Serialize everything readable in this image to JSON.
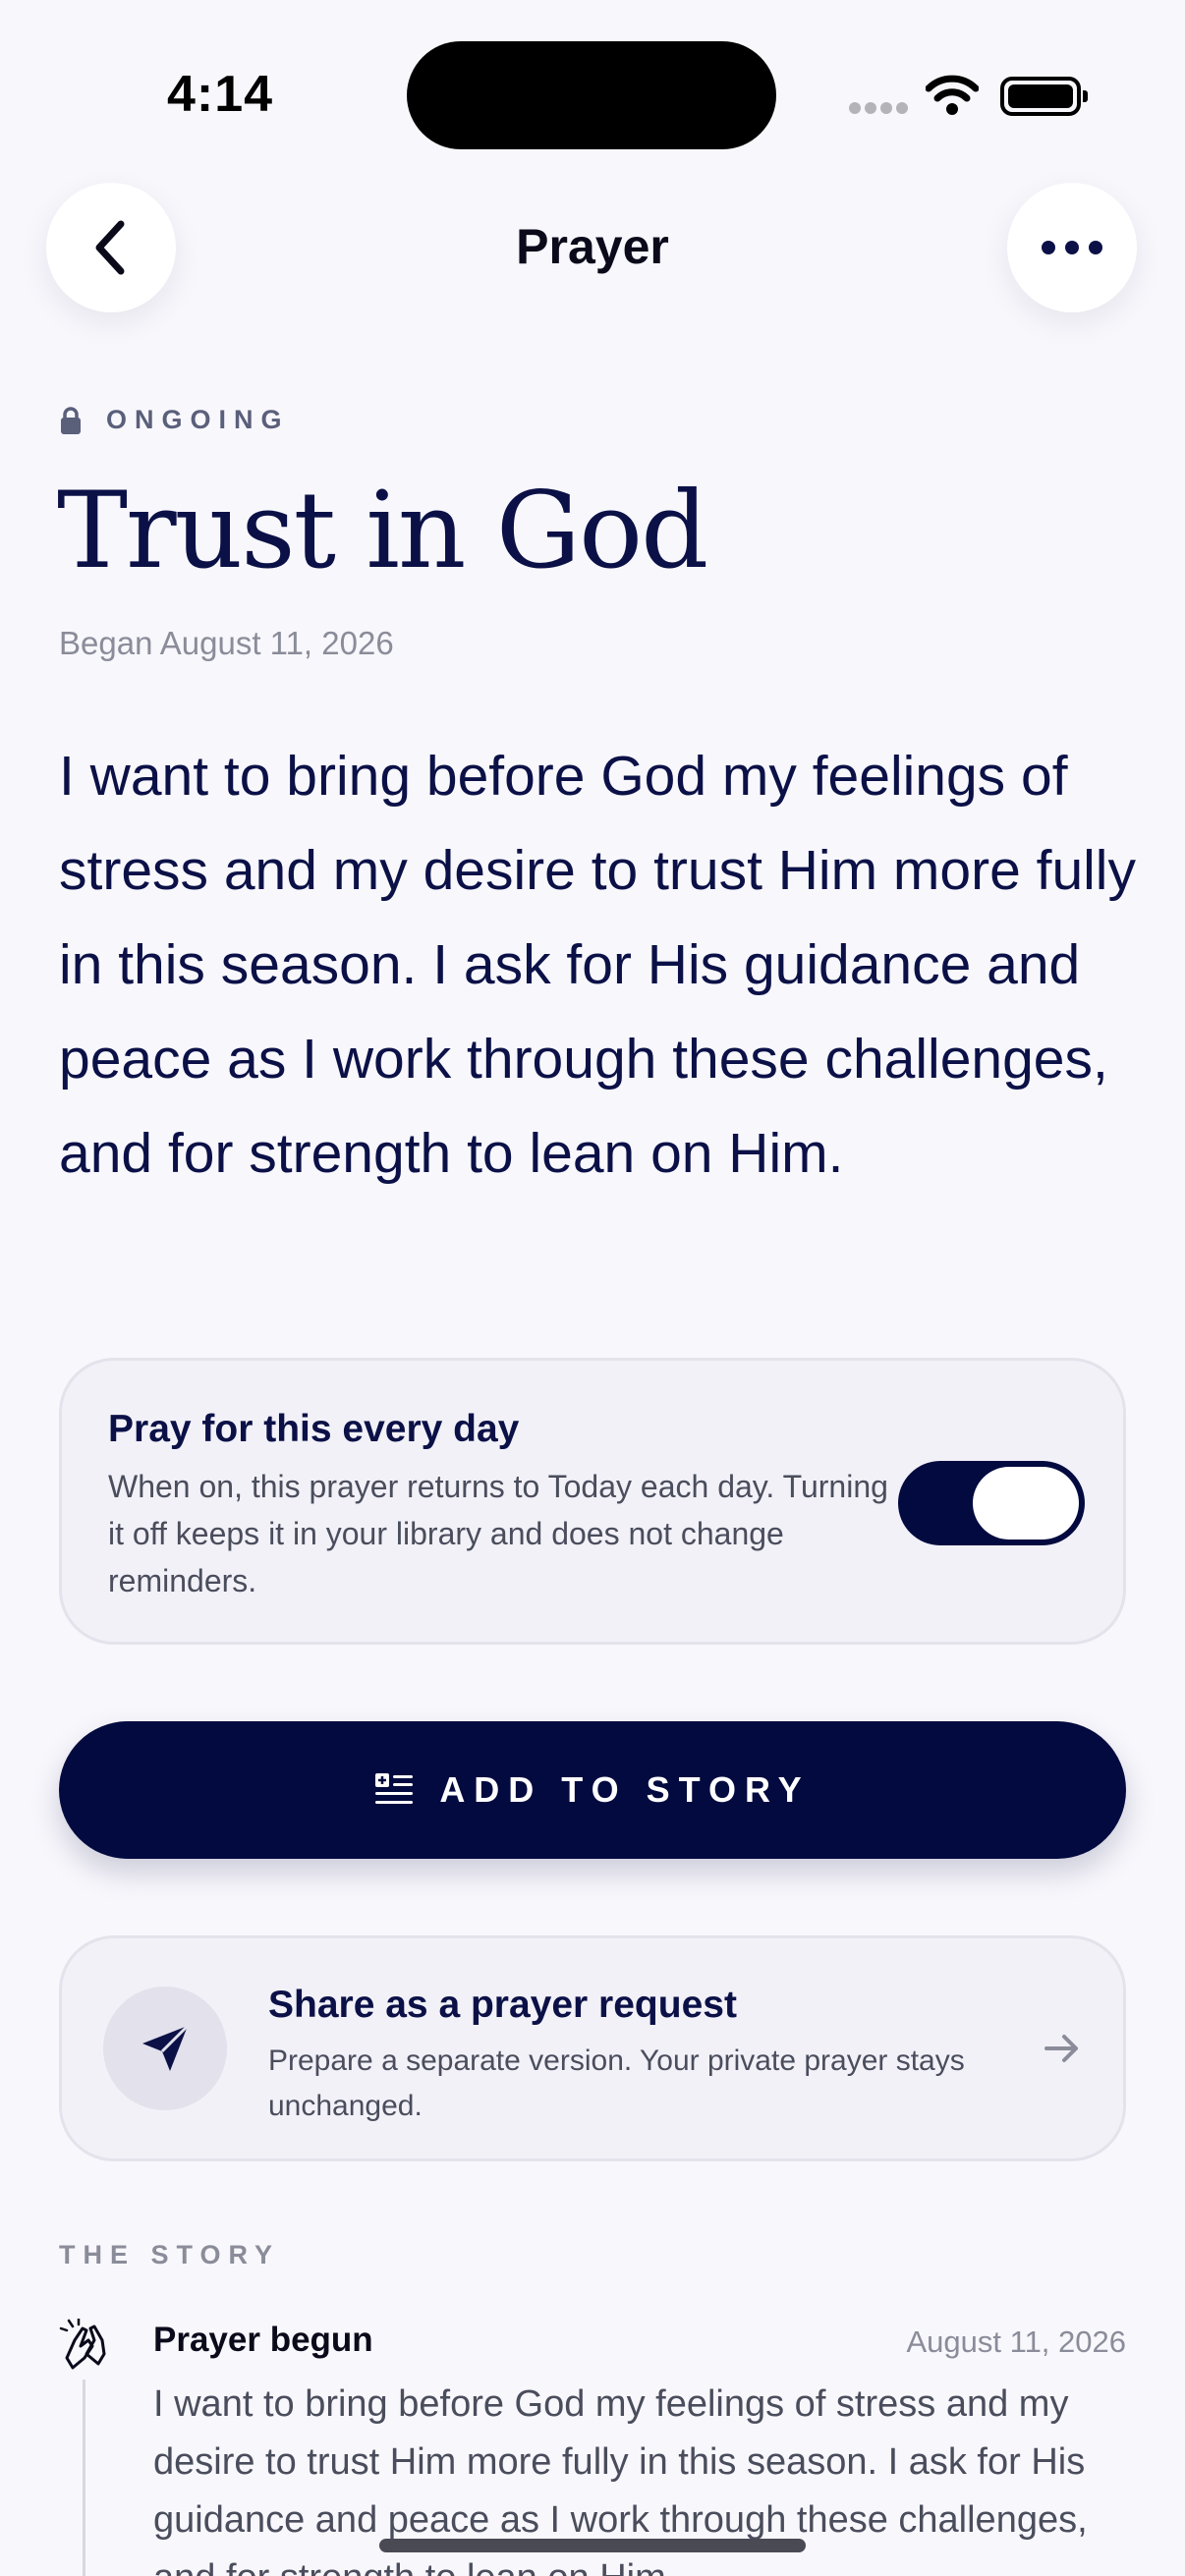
{
  "status_bar": {
    "time": "4:14"
  },
  "nav": {
    "title": "Prayer"
  },
  "prayer": {
    "status": "ONGOING",
    "title": "Trust in God",
    "began": "Began August 11, 2026",
    "body": "I want to bring before God my feelings of stress and my desire to trust Him more fully in this season. I ask for His guidance and peace as I work through these challenges, and for strength to lean on Him."
  },
  "daily_toggle": {
    "title": "Pray for this every day",
    "description": "When on, this prayer returns to Today each day. Turning it off keeps it in your library and does not change reminders.",
    "on": true
  },
  "add_button": {
    "label": "ADD TO STORY"
  },
  "share_card": {
    "title": "Share as a prayer request",
    "description": "Prepare a separate version. Your private prayer stays unchanged."
  },
  "story": {
    "label": "THE STORY",
    "entries": [
      {
        "title": "Prayer begun",
        "date": "August 11, 2026",
        "text": "I want to bring before God my feelings of stress and my desire to trust Him more fully in this season. I ask for His guidance and peace as I work through these challenges, and for strength to lean on Him."
      }
    ]
  },
  "colors": {
    "accent": "#020a3f",
    "text": "#0b1147",
    "background": "#f8f7fc",
    "card": "#f2f1f8"
  },
  "icons": [
    "back-chevron-icon",
    "more-dots-icon",
    "lock-icon",
    "add-story-icon",
    "paper-plane-icon",
    "arrow-right-icon",
    "praying-hands-icon"
  ]
}
